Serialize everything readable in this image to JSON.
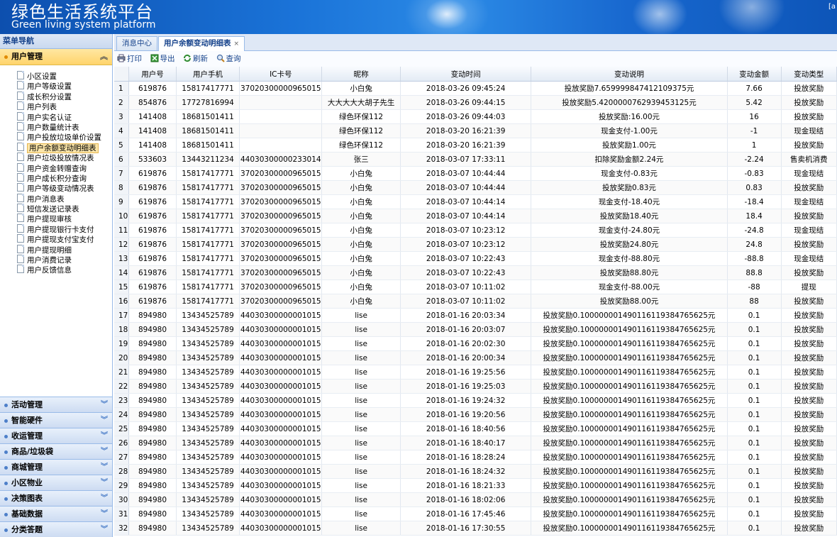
{
  "header": {
    "title": "绿色生活系统平台",
    "subtitle": "Green living system platform",
    "corner": "[a"
  },
  "sidebar": {
    "title": "菜单导航",
    "active_group": "用户管理",
    "items": [
      "小区设置",
      "用户等级设置",
      "成长积分设置",
      "用户列表",
      "用户实名认证",
      "用户数量统计表",
      "用户投放垃圾单价设置",
      "用户余额变动明细表",
      "用户垃圾投放情况表",
      "用户资金转赠查询",
      "用户成长积分查询",
      "用户等级变动情况表",
      "用户消息表",
      "短信发送记录表",
      "用户提现审核",
      "用户提现银行卡支付",
      "用户提现支付宝支付",
      "用户提现明细",
      "用户消费记录",
      "用户反馈信息"
    ],
    "selected_index": 7,
    "groups": [
      "活动管理",
      "智能硬件",
      "收运管理",
      "商品/垃圾袋",
      "商城管理",
      "小区物业",
      "决策图表",
      "基础数据",
      "分类答题"
    ]
  },
  "tabs": [
    {
      "label": "消息中心"
    },
    {
      "label": "用户余额变动明细表",
      "close": "×"
    }
  ],
  "toolbar": {
    "print": "打印",
    "export": "导出",
    "refresh": "刷新",
    "query": "查询"
  },
  "table": {
    "columns": [
      "用户号",
      "用户手机",
      "IC卡号",
      "昵称",
      "变动时间",
      "变动说明",
      "变动金额",
      "变动类型"
    ],
    "rows": [
      [
        "619876",
        "15817417771",
        "37020300000965015",
        "小白兔",
        "2018-03-26 09:45:24",
        "投放奖励7.659999847412109375元",
        "7.66",
        "投放奖励"
      ],
      [
        "854876",
        "17727816994",
        "",
        "大大大大大胡子先生",
        "2018-03-26 09:44:15",
        "投放奖励5.4200000762939453125元",
        "5.42",
        "投放奖励"
      ],
      [
        "141408",
        "18681501411",
        "",
        "绿色环保112",
        "2018-03-26 09:44:03",
        "投放奖励:16.00元",
        "16",
        "投放奖励"
      ],
      [
        "141408",
        "18681501411",
        "",
        "绿色环保112",
        "2018-03-20 16:21:39",
        "现金支付-1.00元",
        "-1",
        "现金现结"
      ],
      [
        "141408",
        "18681501411",
        "",
        "绿色环保112",
        "2018-03-20 16:21:39",
        "投放奖励1.00元",
        "1",
        "投放奖励"
      ],
      [
        "533603",
        "13443211234",
        "44030300000233014",
        "张三",
        "2018-03-07 17:33:11",
        "扣除奖励金额2.24元",
        "-2.24",
        "售卖机消费"
      ],
      [
        "619876",
        "15817417771",
        "37020300000965015",
        "小白兔",
        "2018-03-07 10:44:44",
        "现金支付-0.83元",
        "-0.83",
        "现金现结"
      ],
      [
        "619876",
        "15817417771",
        "37020300000965015",
        "小白兔",
        "2018-03-07 10:44:44",
        "投放奖励0.83元",
        "0.83",
        "投放奖励"
      ],
      [
        "619876",
        "15817417771",
        "37020300000965015",
        "小白兔",
        "2018-03-07 10:44:14",
        "现金支付-18.40元",
        "-18.4",
        "现金现结"
      ],
      [
        "619876",
        "15817417771",
        "37020300000965015",
        "小白兔",
        "2018-03-07 10:44:14",
        "投放奖励18.40元",
        "18.4",
        "投放奖励"
      ],
      [
        "619876",
        "15817417771",
        "37020300000965015",
        "小白兔",
        "2018-03-07 10:23:12",
        "现金支付-24.80元",
        "-24.8",
        "现金现结"
      ],
      [
        "619876",
        "15817417771",
        "37020300000965015",
        "小白兔",
        "2018-03-07 10:23:12",
        "投放奖励24.80元",
        "24.8",
        "投放奖励"
      ],
      [
        "619876",
        "15817417771",
        "37020300000965015",
        "小白兔",
        "2018-03-07 10:22:43",
        "现金支付-88.80元",
        "-88.8",
        "现金现结"
      ],
      [
        "619876",
        "15817417771",
        "37020300000965015",
        "小白兔",
        "2018-03-07 10:22:43",
        "投放奖励88.80元",
        "88.8",
        "投放奖励"
      ],
      [
        "619876",
        "15817417771",
        "37020300000965015",
        "小白兔",
        "2018-03-07 10:11:02",
        "现金支付-88.00元",
        "-88",
        "提现"
      ],
      [
        "619876",
        "15817417771",
        "37020300000965015",
        "小白兔",
        "2018-03-07 10:11:02",
        "投放奖励88.00元",
        "88",
        "投放奖励"
      ],
      [
        "894980",
        "13434525789",
        "44030300000001015",
        "lise",
        "2018-01-16 20:03:34",
        "投放奖励0.100000001490116119384765625元",
        "0.1",
        "投放奖励"
      ],
      [
        "894980",
        "13434525789",
        "44030300000001015",
        "lise",
        "2018-01-16 20:03:07",
        "投放奖励0.100000001490116119384765625元",
        "0.1",
        "投放奖励"
      ],
      [
        "894980",
        "13434525789",
        "44030300000001015",
        "lise",
        "2018-01-16 20:02:30",
        "投放奖励0.100000001490116119384765625元",
        "0.1",
        "投放奖励"
      ],
      [
        "894980",
        "13434525789",
        "44030300000001015",
        "lise",
        "2018-01-16 20:00:34",
        "投放奖励0.100000001490116119384765625元",
        "0.1",
        "投放奖励"
      ],
      [
        "894980",
        "13434525789",
        "44030300000001015",
        "lise",
        "2018-01-16 19:25:56",
        "投放奖励0.100000001490116119384765625元",
        "0.1",
        "投放奖励"
      ],
      [
        "894980",
        "13434525789",
        "44030300000001015",
        "lise",
        "2018-01-16 19:25:03",
        "投放奖励0.100000001490116119384765625元",
        "0.1",
        "投放奖励"
      ],
      [
        "894980",
        "13434525789",
        "44030300000001015",
        "lise",
        "2018-01-16 19:24:32",
        "投放奖励0.100000001490116119384765625元",
        "0.1",
        "投放奖励"
      ],
      [
        "894980",
        "13434525789",
        "44030300000001015",
        "lise",
        "2018-01-16 19:20:56",
        "投放奖励0.100000001490116119384765625元",
        "0.1",
        "投放奖励"
      ],
      [
        "894980",
        "13434525789",
        "44030300000001015",
        "lise",
        "2018-01-16 18:40:56",
        "投放奖励0.100000001490116119384765625元",
        "0.1",
        "投放奖励"
      ],
      [
        "894980",
        "13434525789",
        "44030300000001015",
        "lise",
        "2018-01-16 18:40:17",
        "投放奖励0.100000001490116119384765625元",
        "0.1",
        "投放奖励"
      ],
      [
        "894980",
        "13434525789",
        "44030300000001015",
        "lise",
        "2018-01-16 18:28:24",
        "投放奖励0.100000001490116119384765625元",
        "0.1",
        "投放奖励"
      ],
      [
        "894980",
        "13434525789",
        "44030300000001015",
        "lise",
        "2018-01-16 18:24:32",
        "投放奖励0.100000001490116119384765625元",
        "0.1",
        "投放奖励"
      ],
      [
        "894980",
        "13434525789",
        "44030300000001015",
        "lise",
        "2018-01-16 18:21:33",
        "投放奖励0.100000001490116119384765625元",
        "0.1",
        "投放奖励"
      ],
      [
        "894980",
        "13434525789",
        "44030300000001015",
        "lise",
        "2018-01-16 18:02:06",
        "投放奖励0.100000001490116119384765625元",
        "0.1",
        "投放奖励"
      ],
      [
        "894980",
        "13434525789",
        "44030300000001015",
        "lise",
        "2018-01-16 17:45:46",
        "投放奖励0.100000001490116119384765625元",
        "0.1",
        "投放奖励"
      ],
      [
        "894980",
        "13434525789",
        "44030300000001015",
        "lise",
        "2018-01-16 17:30:55",
        "投放奖励0.100000001490116119384765625元",
        "0.1",
        "投放奖励"
      ]
    ]
  }
}
